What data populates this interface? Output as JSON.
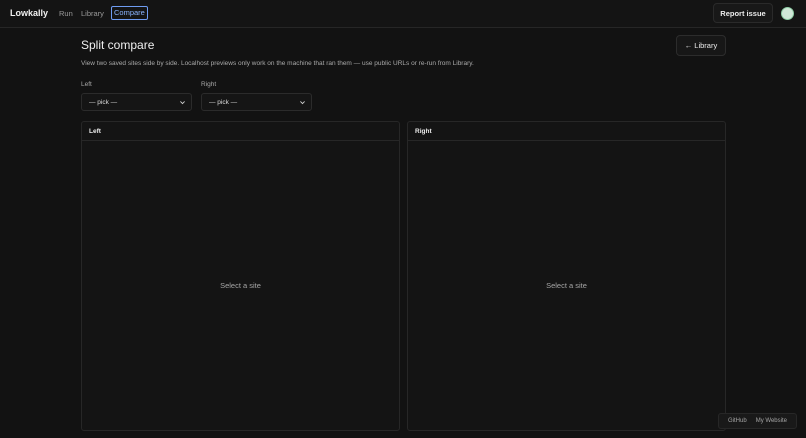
{
  "app": {
    "brand": "Lowkally",
    "nav": {
      "run": "Run",
      "library": "Library",
      "compare": "Compare"
    },
    "report_issue": "Report issue"
  },
  "page": {
    "title": "Split compare",
    "description": "View two saved sites side by side. Localhost previews only work on the machine that ran them — use public URLs or re-run from Library.",
    "back_button": "Library",
    "back_icon": "←"
  },
  "pickers": {
    "left": {
      "label": "Left",
      "value": "— pick —"
    },
    "right": {
      "label": "Right",
      "value": "— pick —"
    }
  },
  "panels": {
    "left": {
      "title": "Left",
      "empty": "Select a site"
    },
    "right": {
      "title": "Right",
      "empty": "Select a site"
    }
  },
  "footer": {
    "github": "GitHub",
    "website": "My Website"
  },
  "colors": {
    "background": "#121212",
    "accent": "#6f9cf2"
  }
}
